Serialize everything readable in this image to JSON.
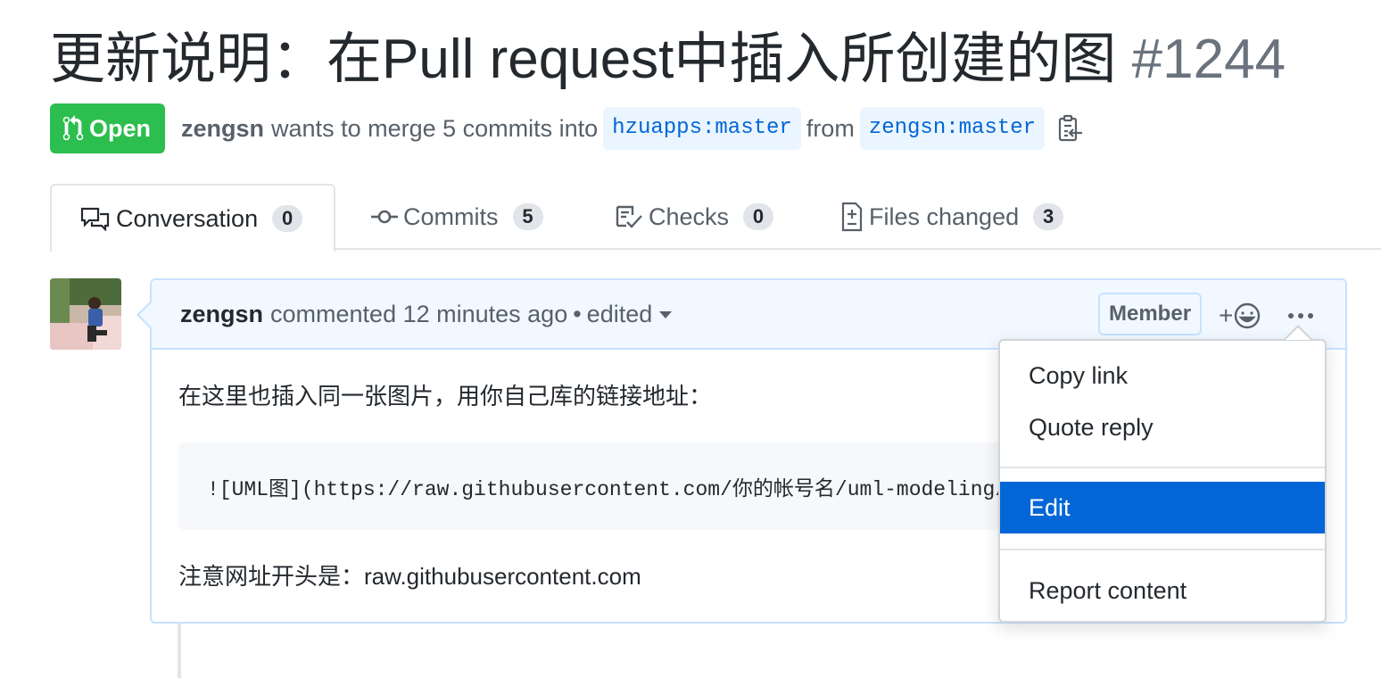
{
  "pr": {
    "title": "更新说明：在Pull request中插入所创建的图",
    "number": "#1244",
    "state": "Open",
    "author": "zengsn",
    "merge_text": "wants to merge 5 commits into",
    "base_branch": "hzuapps:master",
    "from_text": "from",
    "head_branch": "zengsn:master"
  },
  "tabs": [
    {
      "label": "Conversation",
      "count": "0"
    },
    {
      "label": "Commits",
      "count": "5"
    },
    {
      "label": "Checks",
      "count": "0"
    },
    {
      "label": "Files changed",
      "count": "3"
    }
  ],
  "comment": {
    "author": "zengsn",
    "meta": "commented 12 minutes ago",
    "separator": "•",
    "edited": "edited",
    "role_label": "Member",
    "reaction_plus": "+",
    "body_line1": "在这里也插入同一张图片，用你自己库的链接地址：",
    "code": "![UML图](https://raw.githubusercontent.com/你的帐号名/uml-modeling/master/...)",
    "body_line2": "注意网址开头是：raw.githubusercontent.com"
  },
  "menu": {
    "items": [
      "Copy link",
      "Quote reply",
      "Edit",
      "Report content"
    ],
    "selected": "Edit"
  },
  "colors": {
    "open_green": "#2cbe4e",
    "link_blue": "#0366d6",
    "selected_blue": "#0366d6",
    "comment_border": "#c8e1ff",
    "comment_header_bg": "#f1f8ff"
  }
}
